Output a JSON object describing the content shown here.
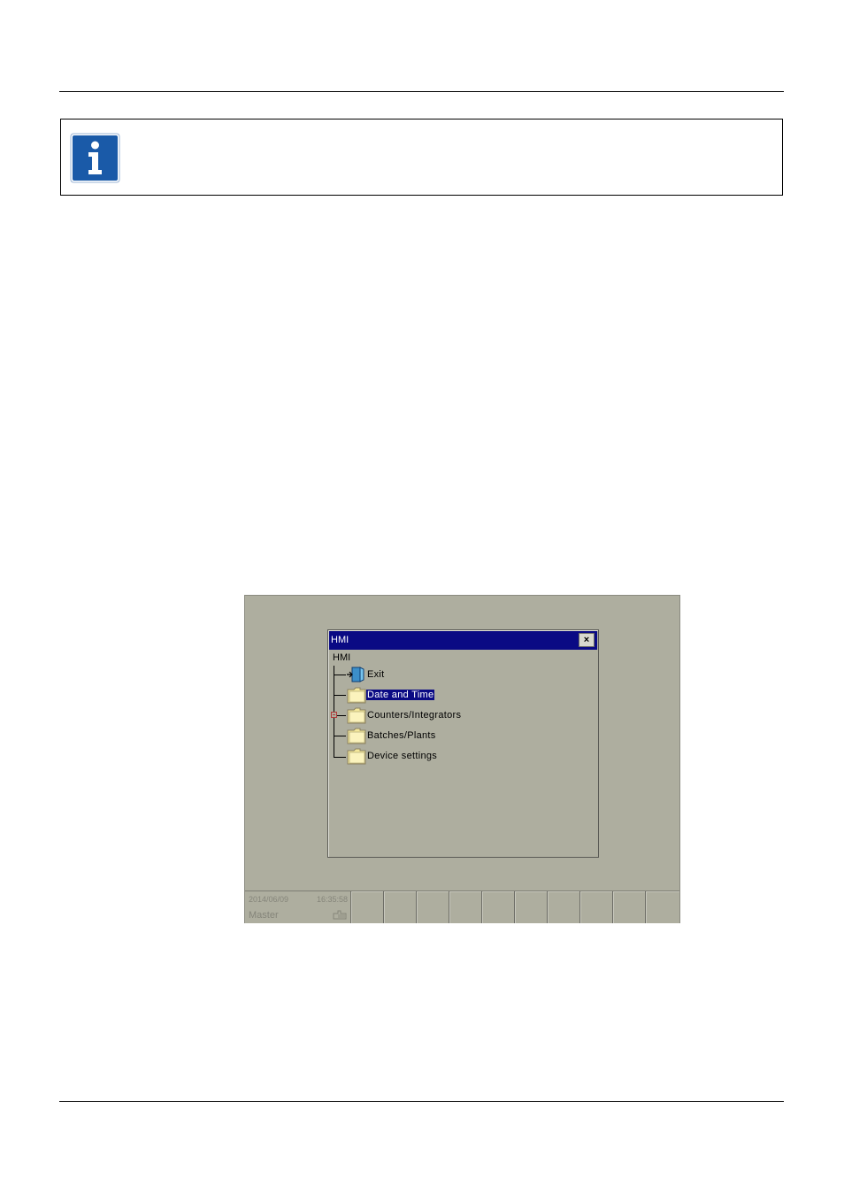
{
  "hmi": {
    "window_title": "HMI",
    "close_label": "×",
    "tree_root": "HMI",
    "items": [
      {
        "label": "Exit",
        "icon": "exit-icon",
        "selected": false,
        "expandable": false
      },
      {
        "label": "Date and Time",
        "icon": "folder-icon",
        "selected": true,
        "expandable": false
      },
      {
        "label": "Counters/Integrators",
        "icon": "folder-icon",
        "selected": false,
        "expandable": true
      },
      {
        "label": "Batches/Plants",
        "icon": "folder-icon",
        "selected": false,
        "expandable": false
      },
      {
        "label": "Device settings",
        "icon": "folder-icon",
        "selected": false,
        "expandable": false
      }
    ],
    "status": {
      "date": "2014/06/09",
      "time": "16:35:58",
      "user": "Master"
    },
    "softkey_count": 10
  },
  "colors": {
    "title_bar": "#0a0a84",
    "screen_bg": "#aeae9f",
    "info_icon_blue": "#1a5aa8"
  }
}
